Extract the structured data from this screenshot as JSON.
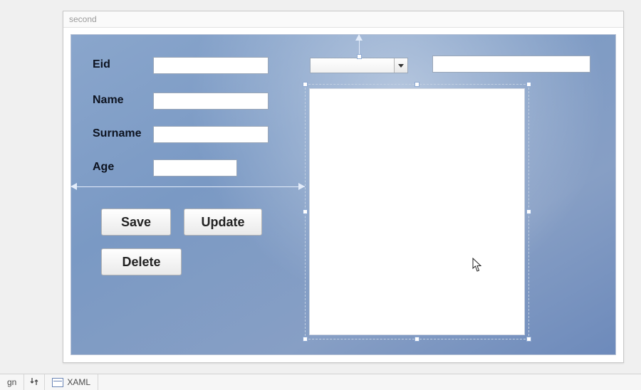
{
  "window": {
    "title": "second"
  },
  "form": {
    "labels": {
      "eid": "Eid",
      "name": "Name",
      "surname": "Surname",
      "age": "Age"
    },
    "values": {
      "eid": "",
      "name": "",
      "surname": "",
      "age": "",
      "combo_selected": "",
      "top_right": ""
    }
  },
  "buttons": {
    "save": "Save",
    "update": "Update",
    "delete": "Delete"
  },
  "tabs": {
    "design": "gn",
    "swap_icon": "swap-icon",
    "xaml": "XAML"
  }
}
